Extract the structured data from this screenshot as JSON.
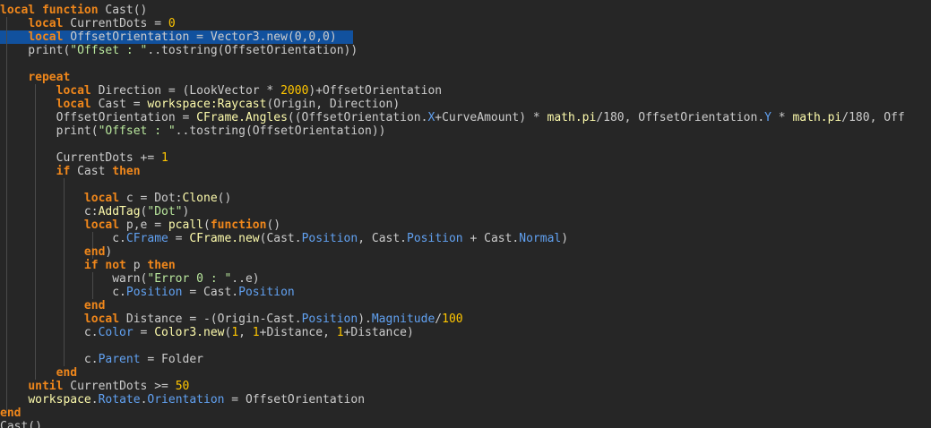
{
  "editor": {
    "colors": {
      "background": "#262626",
      "default_text": "#cccccc",
      "keyword": "#f0871b",
      "number": "#ffc600",
      "string": "#b9e79d",
      "property": "#61a1f1",
      "builtin_call": "#fdfbac",
      "selection": "#11519e"
    },
    "selected_line": 2,
    "lines": [
      [
        [
          "kw",
          "local function"
        ],
        [
          "p",
          " Cast()"
        ]
      ],
      [
        [
          "p",
          "    "
        ],
        [
          "kw",
          "local"
        ],
        [
          "p",
          " CurrentDots = "
        ],
        [
          "num",
          "0"
        ]
      ],
      [
        [
          "p",
          "    "
        ],
        [
          "kw",
          "local"
        ],
        [
          "p",
          " OffsetOrientation = Vector3.new(0,0,0)"
        ]
      ],
      [
        [
          "p",
          "    print("
        ],
        [
          "str",
          "\"Offset : \""
        ],
        [
          "p",
          "..tostring(OffsetOrientation))"
        ]
      ],
      [
        [
          "p",
          ""
        ]
      ],
      [
        [
          "p",
          "    "
        ],
        [
          "kw",
          "repeat"
        ]
      ],
      [
        [
          "p",
          "        "
        ],
        [
          "kw",
          "local"
        ],
        [
          "p",
          " Direction = (LookVector * "
        ],
        [
          "num",
          "2000"
        ],
        [
          "p",
          ")+OffsetOrientation"
        ]
      ],
      [
        [
          "p",
          "        "
        ],
        [
          "kw",
          "local"
        ],
        [
          "p",
          " Cast = "
        ],
        [
          "fn",
          "workspace:Raycast"
        ],
        [
          "p",
          "(Origin, Direction)"
        ]
      ],
      [
        [
          "p",
          "        OffsetOrientation = "
        ],
        [
          "fn",
          "CFrame.Angles"
        ],
        [
          "p",
          "((OffsetOrientation."
        ],
        [
          "prop",
          "X"
        ],
        [
          "p",
          "+CurveAmount) * "
        ],
        [
          "fn",
          "math.pi"
        ],
        [
          "p",
          "/180, OffsetOrientation."
        ],
        [
          "prop",
          "Y"
        ],
        [
          "p",
          " * "
        ],
        [
          "fn",
          "math.pi"
        ],
        [
          "p",
          "/180, Off"
        ]
      ],
      [
        [
          "p",
          "        print("
        ],
        [
          "str",
          "\"Offset : \""
        ],
        [
          "p",
          "..tostring(OffsetOrientation))"
        ]
      ],
      [
        [
          "p",
          ""
        ]
      ],
      [
        [
          "p",
          "        CurrentDots += "
        ],
        [
          "num",
          "1"
        ]
      ],
      [
        [
          "p",
          "        "
        ],
        [
          "kw",
          "if"
        ],
        [
          "p",
          " Cast "
        ],
        [
          "kw",
          "then"
        ]
      ],
      [
        [
          "p",
          ""
        ]
      ],
      [
        [
          "p",
          "            "
        ],
        [
          "kw",
          "local"
        ],
        [
          "p",
          " c = Dot:"
        ],
        [
          "fn",
          "Clone"
        ],
        [
          "p",
          "()"
        ]
      ],
      [
        [
          "p",
          "            c:"
        ],
        [
          "fn",
          "AddTag"
        ],
        [
          "p",
          "("
        ],
        [
          "str",
          "\"Dot\""
        ],
        [
          "p",
          ")"
        ]
      ],
      [
        [
          "p",
          "            "
        ],
        [
          "kw",
          "local"
        ],
        [
          "p",
          " p,e = "
        ],
        [
          "fn",
          "pcall"
        ],
        [
          "p",
          "("
        ],
        [
          "kw",
          "function"
        ],
        [
          "p",
          "()"
        ]
      ],
      [
        [
          "p",
          "                c."
        ],
        [
          "prop",
          "CFrame"
        ],
        [
          "p",
          " = "
        ],
        [
          "fn",
          "CFrame.new"
        ],
        [
          "p",
          "(Cast."
        ],
        [
          "prop",
          "Position"
        ],
        [
          "p",
          ", Cast."
        ],
        [
          "prop",
          "Position"
        ],
        [
          "p",
          " + Cast."
        ],
        [
          "prop",
          "Normal"
        ],
        [
          "p",
          ")"
        ]
      ],
      [
        [
          "p",
          "            "
        ],
        [
          "kw",
          "end"
        ],
        [
          "p",
          ")"
        ]
      ],
      [
        [
          "p",
          "            "
        ],
        [
          "kw",
          "if not"
        ],
        [
          "p",
          " p "
        ],
        [
          "kw",
          "then"
        ]
      ],
      [
        [
          "p",
          "                warn("
        ],
        [
          "str",
          "\"Error 0 : \""
        ],
        [
          "p",
          "..e)"
        ]
      ],
      [
        [
          "p",
          "                c."
        ],
        [
          "prop",
          "Position"
        ],
        [
          "p",
          " = Cast."
        ],
        [
          "prop",
          "Position"
        ]
      ],
      [
        [
          "p",
          "            "
        ],
        [
          "kw",
          "end"
        ]
      ],
      [
        [
          "p",
          "            "
        ],
        [
          "kw",
          "local"
        ],
        [
          "p",
          " Distance = -(Origin-Cast."
        ],
        [
          "prop",
          "Position"
        ],
        [
          "p",
          ")."
        ],
        [
          "prop",
          "Magnitude"
        ],
        [
          "p",
          "/"
        ],
        [
          "num",
          "100"
        ]
      ],
      [
        [
          "p",
          "            c."
        ],
        [
          "prop",
          "Color"
        ],
        [
          "p",
          " = "
        ],
        [
          "fn",
          "Color3.new"
        ],
        [
          "p",
          "("
        ],
        [
          "num",
          "1"
        ],
        [
          "p",
          ", "
        ],
        [
          "num",
          "1"
        ],
        [
          "p",
          "+Distance, "
        ],
        [
          "num",
          "1"
        ],
        [
          "p",
          "+Distance)"
        ]
      ],
      [
        [
          "p",
          ""
        ]
      ],
      [
        [
          "p",
          "            c."
        ],
        [
          "prop",
          "Parent"
        ],
        [
          "p",
          " = Folder"
        ]
      ],
      [
        [
          "p",
          "        "
        ],
        [
          "kw",
          "end"
        ]
      ],
      [
        [
          "p",
          "    "
        ],
        [
          "kw",
          "until"
        ],
        [
          "p",
          " CurrentDots >= "
        ],
        [
          "num",
          "50"
        ]
      ],
      [
        [
          "p",
          "    "
        ],
        [
          "fn",
          "workspace"
        ],
        [
          "p",
          "."
        ],
        [
          "prop",
          "Rotate"
        ],
        [
          "p",
          "."
        ],
        [
          "prop",
          "Orientation"
        ],
        [
          "p",
          " = OffsetOrientation"
        ]
      ],
      [
        [
          "kw",
          "end"
        ]
      ],
      [
        [
          "p",
          "Cast()"
        ]
      ]
    ]
  }
}
